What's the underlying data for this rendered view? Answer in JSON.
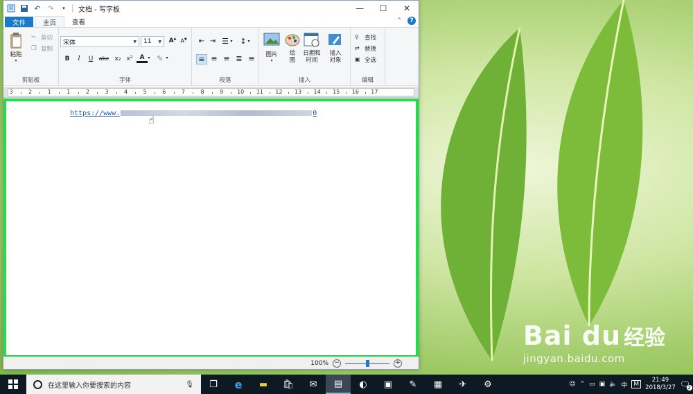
{
  "window": {
    "title": "文档 - 写字板",
    "controls": {
      "minimize": "—",
      "maximize": "☐",
      "close": "✕"
    }
  },
  "tabs": [
    {
      "label": "文件"
    },
    {
      "label": "主页"
    },
    {
      "label": "查看"
    }
  ],
  "ribbon": {
    "clipboard": {
      "paste": "粘贴",
      "cut": "剪切",
      "copy": "复制",
      "label": "剪贴板"
    },
    "font": {
      "family": "宋体",
      "size": "11",
      "bold": "B",
      "italic": "I",
      "underline": "U",
      "strike": "abc",
      "sub": "x₂",
      "sup": "x²",
      "label": "字体"
    },
    "paragraph": {
      "label": "段落"
    },
    "insert": {
      "picture": "图片",
      "paint": "绘图",
      "datetime": "日期和时间",
      "object": "插入对象",
      "label": "插入"
    },
    "editing": {
      "find": "查找",
      "replace": "替换",
      "select_all": "全选",
      "label": "编辑"
    }
  },
  "ruler": {
    "labels": [
      "3",
      "2",
      "1",
      "1",
      "2",
      "3",
      "4",
      "5",
      "6",
      "7",
      "8",
      "9",
      "10",
      "11",
      "12",
      "13",
      "14",
      "15",
      "16",
      "17"
    ]
  },
  "document": {
    "link_start": "https://www.",
    "link_end": "0"
  },
  "status": {
    "zoom": "100%",
    "zoom_level": 0.5
  },
  "taskbar": {
    "search_placeholder": "在这里输入你要搜索的内容",
    "ime": "中",
    "ime_mode": "M",
    "time": "21:49",
    "date": "2018/3/27",
    "notification_count": "2"
  },
  "watermark": {
    "logo": "Bai du",
    "cn": "经验",
    "url": "jingyan.baidu.com"
  }
}
